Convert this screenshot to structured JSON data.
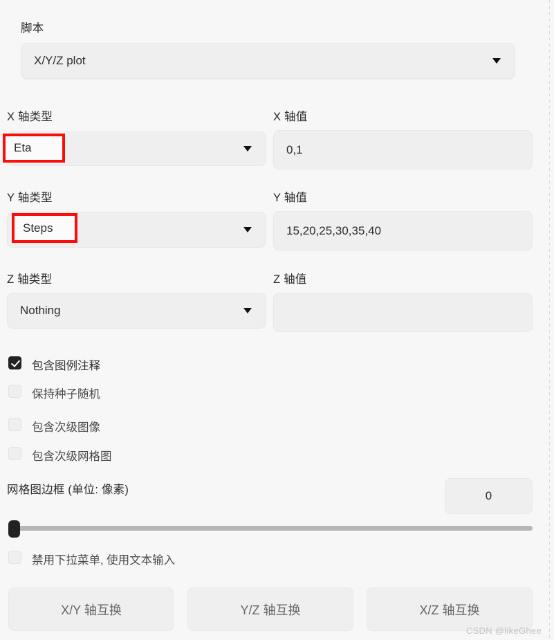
{
  "script_section": {
    "label": "脚本",
    "value": "X/Y/Z plot",
    "caret_icon": "chevron-down-icon"
  },
  "axes": [
    {
      "type_label": "X 轴类型",
      "type_value": "Eta",
      "type_highlighted": true,
      "values_label": "X 轴值",
      "values_value": "0,1",
      "values_placeholder": ""
    },
    {
      "type_label": "Y 轴类型",
      "type_value": "Steps",
      "type_highlighted": true,
      "values_label": "Y 轴值",
      "values_value": "15,20,25,30,35,40",
      "values_placeholder": ""
    },
    {
      "type_label": "Z 轴类型",
      "type_value": "Nothing",
      "type_highlighted": false,
      "values_label": "Z 轴值",
      "values_value": "",
      "values_placeholder": ""
    }
  ],
  "checkboxes": [
    {
      "label": "包含图例注释",
      "checked": true
    },
    {
      "label": "保持种子随机",
      "checked": false
    },
    {
      "label": "包含次级图像",
      "checked": false
    },
    {
      "label": "包含次级网格图",
      "checked": false
    }
  ],
  "margin_setting": {
    "label": "网格图边框 (单位: 像素)",
    "value": "0",
    "slider_value": 0,
    "slider_min": 0,
    "slider_max": 500
  },
  "dropdown_toggle": {
    "label": "禁用下拉菜单, 使用文本输入",
    "checked": false
  },
  "swap_buttons": [
    {
      "label": "X/Y 轴互换"
    },
    {
      "label": "Y/Z 轴互换"
    },
    {
      "label": "X/Z 轴互换"
    }
  ],
  "watermark": "CSDN @likeGhee",
  "colors": {
    "background": "#f7f7f7",
    "control_fill": "#efefef",
    "highlight": "#fb0d0d",
    "checkbox_on": "#222222",
    "slider_track": "#b6b6b6"
  }
}
